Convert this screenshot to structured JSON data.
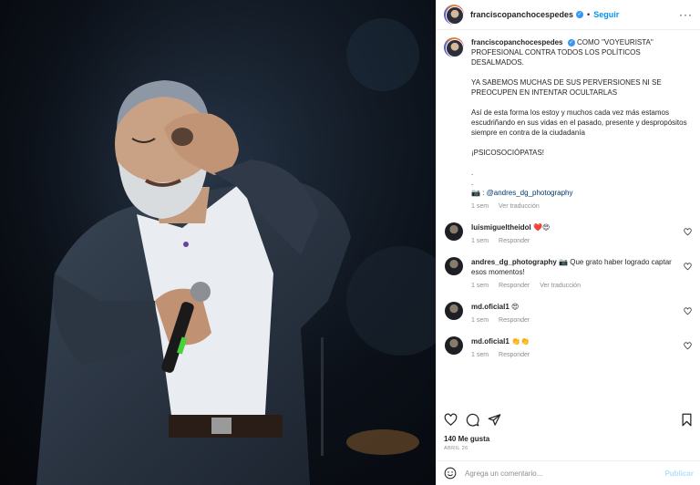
{
  "photo": {
    "description_icon": "photo-of-singer-with-microphone"
  },
  "header": {
    "username": "franciscopanchocespedes",
    "verified_icon": "verified-badge-icon",
    "separator": "•",
    "follow_label": "Seguir",
    "more_label": "···"
  },
  "caption": {
    "username": "franciscopanchocespedes",
    "line1": "COMO \"VOYEURISTA\" PROFESIONAL CONTRA TODOS LOS POLÍTICOS DESALMADOS.",
    "line2": "YA SABEMOS MUCHAS DE SUS PERVERSIONES NI SE PREOCUPEN EN INTENTAR OCULTARLAS",
    "line3": "Así de esta forma los estoy y muchos cada vez más estamos escudriñando en sus vidas en el pasado, presente y despropósitos siempre en contra de la ciudadanía",
    "line4": "¡PSICOSOCIÓPATAS!",
    "dot1": ".",
    "dot2": ".",
    "credit_prefix": "📷 : ",
    "credit_mention": "@andres_dg_photography",
    "time": "1 sem",
    "translate": "Ver traducción"
  },
  "comments": [
    {
      "username": "luismigueltheidol",
      "text": "❤️😍",
      "time": "1 sem",
      "reply": "Responder",
      "translate": ""
    },
    {
      "username": "andres_dg_photography",
      "text": "📷 Que grato haber logrado captar esos momentos!",
      "time": "1 sem",
      "reply": "Responder",
      "translate": "Ver traducción"
    },
    {
      "username": "md.oficial1",
      "text": "😍",
      "time": "1 sem",
      "reply": "Responder",
      "translate": ""
    },
    {
      "username": "md.oficial1",
      "text": "👏👏",
      "time": "1 sem",
      "reply": "Responder",
      "translate": ""
    }
  ],
  "actions": {
    "like_icon": "heart-icon",
    "comment_icon": "comment-icon",
    "share_icon": "send-icon",
    "save_icon": "bookmark-icon"
  },
  "likes": "140 Me gusta",
  "date": "ABRIL 26",
  "add_comment": {
    "placeholder": "Agrega un comentario...",
    "publish_label": "Publicar"
  }
}
